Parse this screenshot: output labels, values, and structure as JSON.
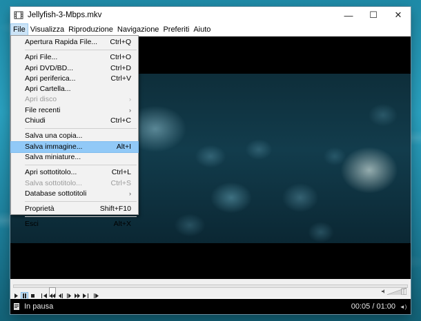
{
  "window": {
    "title": "Jellyfish-3-Mbps.mkv",
    "controls": {
      "minimize": "—",
      "maximize": "☐",
      "close": "✕"
    }
  },
  "menubar": {
    "items": [
      "File",
      "Visualizza",
      "Riproduzione",
      "Navigazione",
      "Preferiti",
      "Aiuto"
    ]
  },
  "file_menu": {
    "items": [
      {
        "label": "Apertura Rapida File...",
        "shortcut": "Ctrl+Q"
      },
      {
        "separator": true
      },
      {
        "label": "Apri File...",
        "shortcut": "Ctrl+O"
      },
      {
        "label": "Apri DVD/BD...",
        "shortcut": "Ctrl+D"
      },
      {
        "label": "Apri periferica...",
        "shortcut": "Ctrl+V"
      },
      {
        "label": "Apri Cartella...",
        "shortcut": ""
      },
      {
        "label": "Apri disco",
        "submenu": true,
        "disabled": true
      },
      {
        "label": "File recenti",
        "submenu": true
      },
      {
        "label": "Chiudi",
        "shortcut": "Ctrl+C"
      },
      {
        "separator": true
      },
      {
        "label": "Salva una copia...",
        "shortcut": ""
      },
      {
        "label": "Salva immagine...",
        "shortcut": "Alt+I",
        "highlight": true
      },
      {
        "label": "Salva miniature...",
        "shortcut": ""
      },
      {
        "separator": true
      },
      {
        "label": "Apri sottotitolo...",
        "shortcut": "Ctrl+L"
      },
      {
        "label": "Salva sottotitolo...",
        "shortcut": "Ctrl+S",
        "disabled": true
      },
      {
        "label": "Database sottotitoli",
        "submenu": true
      },
      {
        "separator": true
      },
      {
        "label": "Proprietà",
        "shortcut": "Shift+F10"
      },
      {
        "separator": true
      },
      {
        "label": "Esci",
        "shortcut": "Alt+X"
      }
    ]
  },
  "player": {
    "seek_position_fraction": 0.09,
    "status": "In pausa",
    "time": "00:05 / 01:00"
  },
  "colors": {
    "highlight": "#91c9f7",
    "status_bg": "#000000"
  }
}
